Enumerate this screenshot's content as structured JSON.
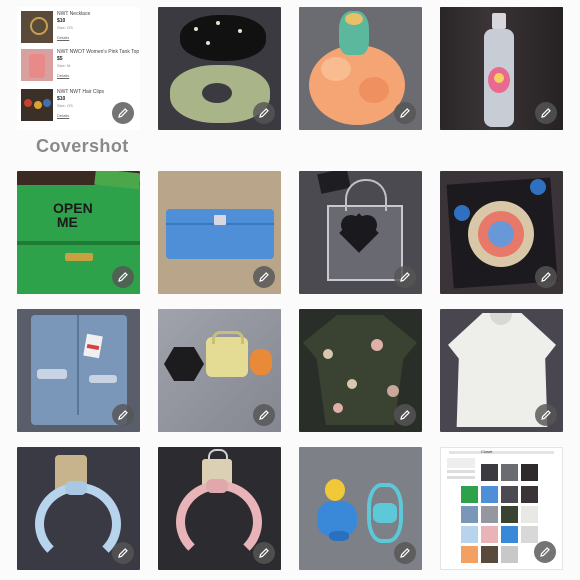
{
  "section": {
    "title": "Covershot"
  },
  "mini_listings": [
    {
      "title": "NWT Necklace",
      "price": "$10",
      "size": "Size: OS",
      "link": "Details"
    },
    {
      "title": "NWT NWOT Women's Pink Tank Top",
      "price": "$5",
      "size": "Size: M",
      "link": "Details"
    },
    {
      "title": "NWT NWT Hair Clips",
      "price": "$10",
      "size": "Size: OS",
      "link": "Details"
    }
  ],
  "tiles": [
    {
      "name": "listing-screenshot-tile",
      "alt": "Screenshot of listings"
    },
    {
      "name": "scrunchies-tile",
      "alt": "Scrunchies"
    },
    {
      "name": "loofah-tile",
      "alt": "Mermaid loofah"
    },
    {
      "name": "bottle-tile",
      "alt": "Body wash bottle"
    },
    {
      "name": "jewelry-box-tile",
      "alt": "Green jewelry box"
    },
    {
      "name": "wallet-tile",
      "alt": "Blue wallet"
    },
    {
      "name": "clear-tote-tile",
      "alt": "Clear heart tote"
    },
    {
      "name": "nail-kit-tile",
      "alt": "Press-on nail kit"
    },
    {
      "name": "denim-shorts-tile",
      "alt": "Denim shorts"
    },
    {
      "name": "toys-tile",
      "alt": "Toys"
    },
    {
      "name": "floral-kimono-tile",
      "alt": "Floral kimono"
    },
    {
      "name": "white-blouse-tile",
      "alt": "White blouse"
    },
    {
      "name": "blue-headband-tile",
      "alt": "Blue headband"
    },
    {
      "name": "pink-headband-tile",
      "alt": "Pink headband"
    },
    {
      "name": "bath-toys-tile",
      "alt": "Bath toys"
    },
    {
      "name": "closet-screenshot-tile",
      "alt": "Closet screenshot"
    }
  ],
  "closet_screenshot": {
    "header": "Closet"
  },
  "icons": {
    "edit": "pencil-icon"
  },
  "colors": {
    "edit_badge": "#555555",
    "title_gray": "#8a8a8a"
  }
}
